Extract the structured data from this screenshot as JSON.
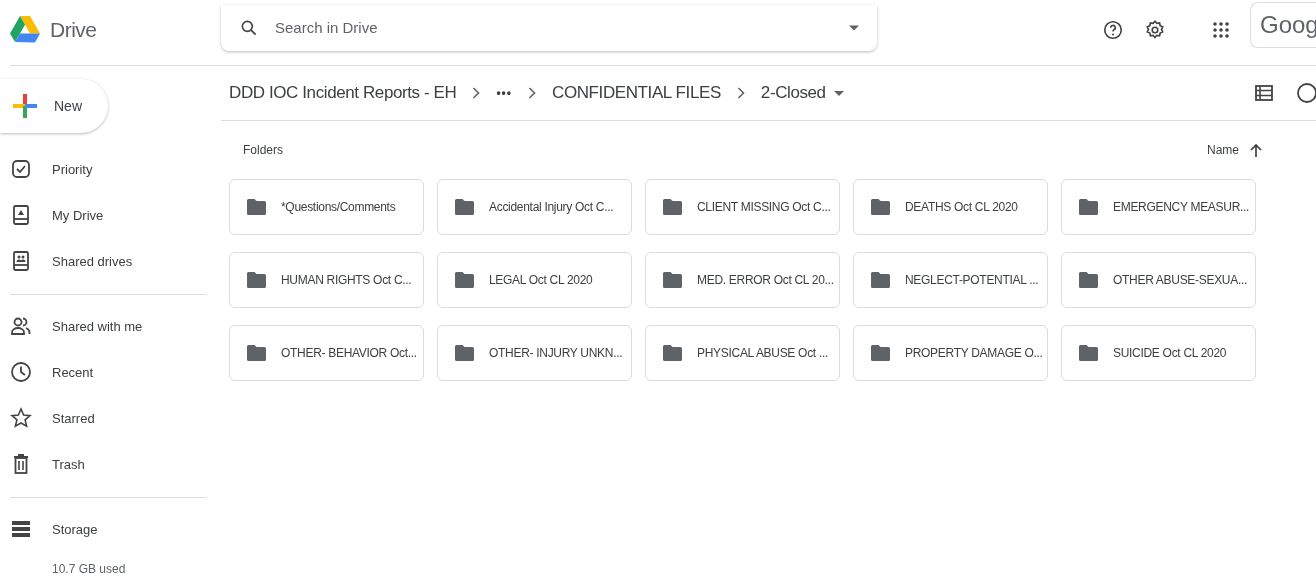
{
  "app": {
    "name": "Drive"
  },
  "search": {
    "placeholder": "Search in Drive"
  },
  "account": {
    "label": "Goog"
  },
  "new_button": {
    "label": "New"
  },
  "sidebar": {
    "groups": [
      {
        "items": [
          {
            "label": "Priority",
            "kind": "priority",
            "selected": false
          },
          {
            "label": "My Drive",
            "kind": "mydrive",
            "selected": false
          },
          {
            "label": "Shared drives",
            "kind": "shareddrives",
            "selected": false
          }
        ]
      },
      {
        "items": [
          {
            "label": "Shared with me",
            "kind": "shared",
            "selected": false
          },
          {
            "label": "Recent",
            "kind": "recent",
            "selected": false
          },
          {
            "label": "Starred",
            "kind": "starred",
            "selected": false
          },
          {
            "label": "Trash",
            "kind": "trash",
            "selected": false
          }
        ]
      },
      {
        "items": [
          {
            "label": "Storage",
            "kind": "storage",
            "selected": false
          }
        ]
      }
    ],
    "storage_used": "10.7 GB used"
  },
  "breadcrumb": [
    {
      "label": "DDD IOC Incident Reports - EH",
      "kind": "folder"
    },
    {
      "label": "•••",
      "kind": "more"
    },
    {
      "label": "CONFIDENTIAL FILES",
      "kind": "folder"
    },
    {
      "label": "2-Closed",
      "kind": "current"
    }
  ],
  "section_title": "Folders",
  "sort": {
    "label": "Name",
    "ascending": true
  },
  "folders": [
    {
      "name": "*Questions/Comments"
    },
    {
      "name": "Accidental Injury Oct C..."
    },
    {
      "name": "CLIENT MISSING Oct C..."
    },
    {
      "name": "DEATHS Oct CL 2020"
    },
    {
      "name": "EMERGENCY MEASUR..."
    },
    {
      "name": "HUMAN RIGHTS Oct C..."
    },
    {
      "name": "LEGAL Oct CL 2020"
    },
    {
      "name": "MED. ERROR Oct CL 20..."
    },
    {
      "name": "NEGLECT-POTENTIAL ..."
    },
    {
      "name": "OTHER ABUSE-SEXUA..."
    },
    {
      "name": "OTHER- BEHAVIOR Oct..."
    },
    {
      "name": "OTHER- INJURY UNKN..."
    },
    {
      "name": "PHYSICAL ABUSE Oct ..."
    },
    {
      "name": "PROPERTY DAMAGE O..."
    },
    {
      "name": "SUICIDE Oct CL 2020"
    }
  ]
}
